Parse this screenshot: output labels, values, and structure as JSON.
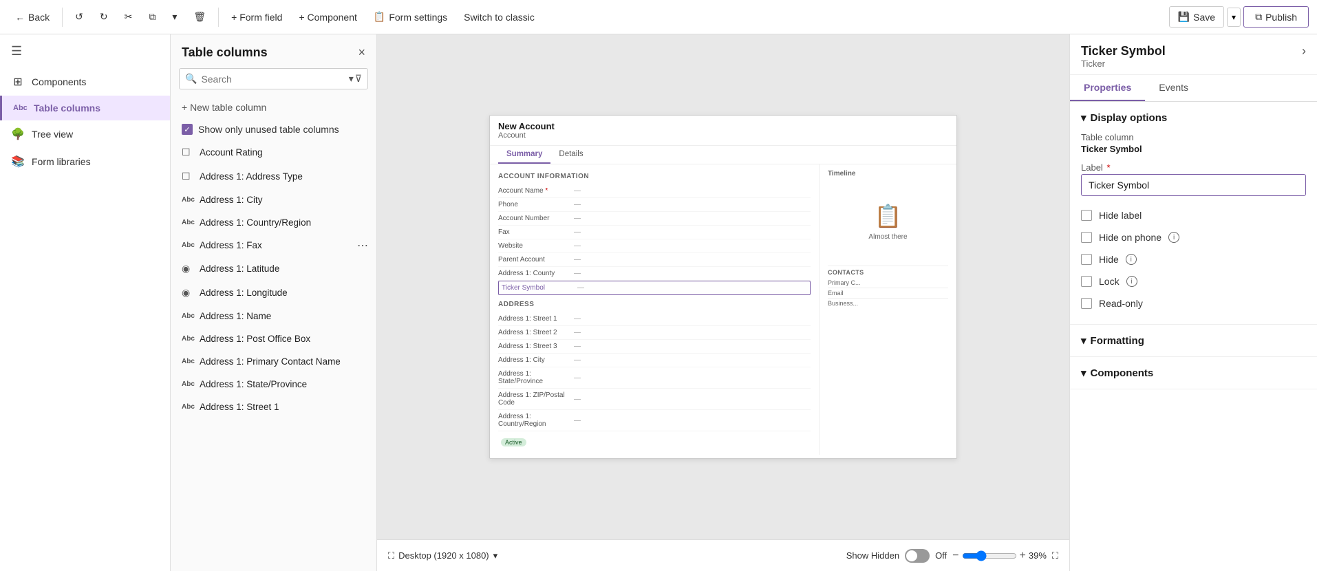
{
  "toolbar": {
    "back_label": "Back",
    "form_field_label": "+ Form field",
    "component_label": "+ Component",
    "form_settings_label": "Form settings",
    "switch_classic_label": "Switch to classic",
    "save_label": "Save",
    "publish_label": "Publish"
  },
  "left_nav": {
    "hamburger_title": "Menu",
    "items": [
      {
        "id": "components",
        "label": "Components",
        "icon": "⊞"
      },
      {
        "id": "table-columns",
        "label": "Table columns",
        "icon": "Abc",
        "active": true
      },
      {
        "id": "tree-view",
        "label": "Tree view",
        "icon": "🌳"
      },
      {
        "id": "form-libraries",
        "label": "Form libraries",
        "icon": "📚"
      }
    ]
  },
  "table_columns_panel": {
    "title": "Table columns",
    "close_label": "×",
    "search": {
      "placeholder": "Search",
      "value": ""
    },
    "new_column_label": "+ New table column",
    "show_unused_label": "Show only unused table columns",
    "columns": [
      {
        "id": "account-rating",
        "label": "Account Rating",
        "icon": "☐",
        "type": "checkbox"
      },
      {
        "id": "address-type",
        "label": "Address 1: Address Type",
        "icon": "☐",
        "type": "text"
      },
      {
        "id": "address-city",
        "label": "Address 1: City",
        "icon": "Abc",
        "type": "text"
      },
      {
        "id": "address-country",
        "label": "Address 1: Country/Region",
        "icon": "Abc",
        "type": "text"
      },
      {
        "id": "address-fax",
        "label": "Address 1: Fax",
        "icon": "Abc",
        "type": "text",
        "has_more": true
      },
      {
        "id": "address-latitude",
        "label": "Address 1: Latitude",
        "icon": "◉",
        "type": "geo"
      },
      {
        "id": "address-longitude",
        "label": "Address 1: Longitude",
        "icon": "◉",
        "type": "geo"
      },
      {
        "id": "address-name",
        "label": "Address 1: Name",
        "icon": "Abc",
        "type": "text"
      },
      {
        "id": "address-pobox",
        "label": "Address 1: Post Office Box",
        "icon": "Abc",
        "type": "text"
      },
      {
        "id": "address-primary-contact",
        "label": "Address 1: Primary Contact Name",
        "icon": "Abc",
        "type": "text"
      },
      {
        "id": "address-state",
        "label": "Address 1: State/Province",
        "icon": "Abc",
        "type": "text"
      },
      {
        "id": "address-street1",
        "label": "Address 1: Street 1",
        "icon": "Abc",
        "type": "text"
      }
    ]
  },
  "preview": {
    "form_title": "New Account",
    "form_sub": "Account",
    "tabs": [
      "Summary",
      "Details"
    ],
    "active_tab": "Summary",
    "account_info_section": "ACCOUNT INFORMATION",
    "fields": [
      {
        "label": "Account Name",
        "value": "—",
        "required": true
      },
      {
        "label": "Phone",
        "value": "—"
      },
      {
        "label": "Account Number",
        "value": "—"
      },
      {
        "label": "Fax",
        "value": "—"
      },
      {
        "label": "Website",
        "value": "—"
      },
      {
        "label": "Parent Account",
        "value": "—"
      },
      {
        "label": "Address 1: County",
        "value": "—"
      },
      {
        "label": "Ticker Symbol",
        "value": "—",
        "highlighted": true
      }
    ],
    "address_section": "ADDRESS",
    "address_fields": [
      {
        "label": "Address 1: Street 1",
        "value": "—"
      },
      {
        "label": "Address 1: Street 2",
        "value": "—"
      },
      {
        "label": "Address 1: Street 3",
        "value": "—"
      },
      {
        "label": "Address 1: City",
        "value": "—"
      },
      {
        "label": "Address 1: State/Province",
        "value": "—"
      },
      {
        "label": "Address 1: ZIP/Postal Code",
        "value": "—"
      },
      {
        "label": "Address 1: Country/Region",
        "value": "—"
      }
    ],
    "timeline_label": "Timeline",
    "almost_there_label": "Almost there",
    "right_sections": [
      "Primary C...",
      "Email",
      "Business..."
    ],
    "contacts_label": "CONTACTS",
    "status_label": "Active",
    "desktop_label": "Desktop (1920 x 1080)",
    "show_hidden_label": "Show Hidden",
    "hidden_toggle": "Off",
    "zoom_label": "39%",
    "zoom_minus": "−",
    "zoom_plus": "+"
  },
  "right_panel": {
    "title": "Ticker Symbol",
    "subtitle": "Ticker",
    "chevron": "›",
    "tabs": [
      "Properties",
      "Events"
    ],
    "active_tab": "Properties",
    "display_options": {
      "section_title": "Display options",
      "table_column_label": "Table column",
      "table_column_value": "Ticker Symbol",
      "label_field_label": "Label",
      "label_field_value": "Ticker Symbol",
      "required_star": "*",
      "checkboxes": [
        {
          "id": "hide-label",
          "label": "Hide label",
          "checked": false
        },
        {
          "id": "hide-on-phone",
          "label": "Hide on phone",
          "checked": false,
          "has_info": true
        },
        {
          "id": "hide",
          "label": "Hide",
          "checked": false,
          "has_info": true
        },
        {
          "id": "lock",
          "label": "Lock",
          "checked": false,
          "has_info": true
        },
        {
          "id": "read-only",
          "label": "Read-only",
          "checked": false
        }
      ]
    },
    "formatting": {
      "section_title": "Formatting"
    },
    "components": {
      "section_title": "Components"
    }
  }
}
